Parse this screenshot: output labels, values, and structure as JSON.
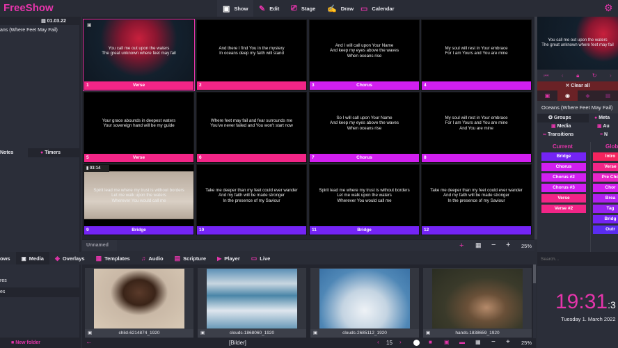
{
  "app": {
    "title": "FreeShow",
    "colors": {
      "accent": "#e535ab",
      "verse": "#f22587",
      "chorus": "#d11ff0",
      "bridge": "#7424f5"
    }
  },
  "nav": [
    {
      "label": "Show",
      "icon": "monitor-play-icon"
    },
    {
      "label": "Edit",
      "icon": "pencil-icon"
    },
    {
      "label": "Stage",
      "icon": "cast-icon"
    },
    {
      "label": "Draw",
      "icon": "draw-icon"
    },
    {
      "label": "Calendar",
      "icon": "calendar-icon"
    }
  ],
  "left": {
    "date": "01.03.22",
    "show": "ans (Where Feet May Fail)",
    "tabs": [
      "Notes",
      "Timers"
    ]
  },
  "slides": [
    {
      "n": "1",
      "group": "Verse",
      "type": "verse",
      "text": "You call me out upon the waters\nThe great unknown where feet may fail"
    },
    {
      "n": "2",
      "group": "",
      "type": "verse",
      "text": "And there I find You in the mystery\nIn oceans deep my faith will stand"
    },
    {
      "n": "3",
      "group": "Chorus",
      "type": "chorus",
      "text": "And I will call upon Your Name\nAnd keep my eyes above the waves\nWhen oceans rise"
    },
    {
      "n": "4",
      "group": "",
      "type": "chorus",
      "text": "My soul will rest in Your embrace\nFor I am Yours and You are mine"
    },
    {
      "n": "5",
      "group": "Verse",
      "type": "verse",
      "text": "Your grace abounds in deepest waters\nYour sovereign hand will be my guide"
    },
    {
      "n": "6",
      "group": "",
      "type": "verse",
      "text": "Where feet may fail and fear surrounds me\nYou've never failed and You won't start now"
    },
    {
      "n": "7",
      "group": "Chorus",
      "type": "chorus",
      "text": "So I will call upon Your Name\nAnd keep my eyes above the waves\nWhen oceans rise"
    },
    {
      "n": "8",
      "group": "",
      "type": "chorus",
      "text": "My soul will rest in Your embrace\nFor I am Yours and You are mine\nAnd You are mine"
    },
    {
      "n": "9",
      "group": "Bridge",
      "type": "bridge",
      "text": "Spirit lead me where my trust is without borders\nLet me walk upon the waters\nWherever You would call me",
      "duration": "03:14"
    },
    {
      "n": "10",
      "group": "",
      "type": "bridge",
      "text": "Take me deeper than my feet could ever wander\nAnd my faith will be made stronger\nIn the presence of my Saviour"
    },
    {
      "n": "11",
      "group": "Bridge",
      "type": "bridge",
      "text": "Spirit lead me where my trust is without borders\nLet me walk upon the waters\nWherever You would call me"
    },
    {
      "n": "12",
      "group": "",
      "type": "bridge",
      "text": "Take me deeper than my feet could ever wander\nAnd my faith will be made stronger\nIn the presence of my Saviour"
    }
  ],
  "toolbar": {
    "tab": "Unnamed",
    "zoom": "25%"
  },
  "right": {
    "preview_text": "You call me out upon the waters\nThe great unknown where feet may fail",
    "clear_all": "Clear all",
    "show_title": "Oceans (Where Feet May Fail)",
    "tabs": [
      "Groups",
      "Meta",
      "Media",
      "Au",
      "Transitions",
      "N"
    ],
    "current_label": "Current",
    "global_label": "Glob",
    "current": [
      {
        "label": "Bridge",
        "color": "#7424f5"
      },
      {
        "label": "Chorus",
        "color": "#d11ff0"
      },
      {
        "label": "Chorus #2",
        "color": "#d11ff0"
      },
      {
        "label": "Chorus #3",
        "color": "#d11ff0"
      },
      {
        "label": "Verse",
        "color": "#f22587"
      },
      {
        "label": "Verse #2",
        "color": "#f22587"
      }
    ],
    "global": [
      {
        "label": "Intro",
        "color": "#f5245e"
      },
      {
        "label": "Verse",
        "color": "#f22587"
      },
      {
        "label": "Pre Cho",
        "color": "#e825c8"
      },
      {
        "label": "Chor",
        "color": "#d11ff0"
      },
      {
        "label": "Brea",
        "color": "#b020f0"
      },
      {
        "label": "Tag",
        "color": "#9622f0"
      },
      {
        "label": "Bridg",
        "color": "#7424f5"
      },
      {
        "label": "Outr",
        "color": "#5a2cf0"
      }
    ]
  },
  "bottom": {
    "tabs": [
      "ows",
      "Media",
      "Overlays",
      "Templates",
      "Audio",
      "Scripture",
      "Player",
      "Live"
    ],
    "folders": [
      "res",
      "es"
    ],
    "new_folder": "New folder",
    "media": [
      {
        "name": "child-6214874_1920"
      },
      {
        "name": "clouds-1868060_1920"
      },
      {
        "name": "clouds-2685112_1920"
      },
      {
        "name": "hands-1838659_1920"
      }
    ],
    "path": "[Bilder]",
    "page": "15",
    "zoom": "25%",
    "search_placeholder": "Search...",
    "clock": {
      "hm": "19:31",
      "sec": ":3",
      "date": "Tuesday 1. March 2022"
    }
  }
}
